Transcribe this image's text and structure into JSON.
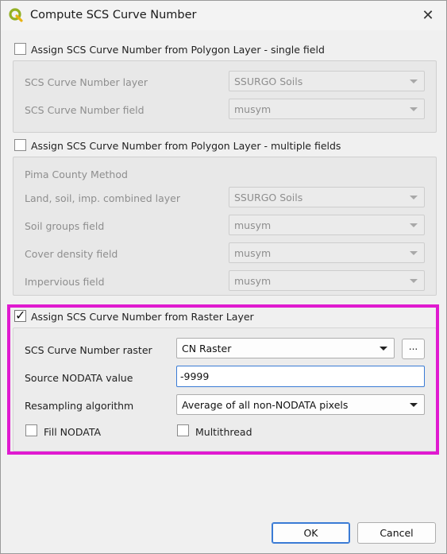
{
  "window": {
    "title": "Compute SCS Curve Number",
    "close_icon": "✕"
  },
  "single_field": {
    "label": "Assign SCS Curve Number from Polygon Layer - single field",
    "checked": false,
    "layer_label": "SCS Curve Number layer",
    "layer_value": "SSURGO Soils",
    "field_label": "SCS Curve Number field",
    "field_value": "musym"
  },
  "multiple_fields": {
    "label": "Assign SCS Curve Number from Polygon Layer - multiple fields",
    "checked": false,
    "method_label": "Pima County Method",
    "combined_label": "Land, soil, imp. combined layer",
    "combined_value": "SSURGO Soils",
    "soil_label": "Soil groups field",
    "soil_value": "musym",
    "cover_label": "Cover density field",
    "cover_value": "musym",
    "impervious_label": "Impervious field",
    "impervious_value": "musym"
  },
  "raster": {
    "label": "Assign SCS Curve Number from Raster Layer",
    "checked": true,
    "raster_label": "SCS Curve Number raster",
    "raster_value": "CN Raster",
    "browse_label": "...",
    "nodata_label": "Source NODATA value",
    "nodata_value": "-9999",
    "resample_label": "Resampling algorithm",
    "resample_value": "Average of all non-NODATA pixels",
    "fill_nodata_label": "Fill NODATA",
    "fill_nodata_checked": false,
    "multithread_label": "Multithread",
    "multithread_checked": false
  },
  "buttons": {
    "ok": "OK",
    "cancel": "Cancel"
  },
  "colors": {
    "highlight": "#e01ad0",
    "focus": "#3a7bd5",
    "qgis_green": "#93b023"
  }
}
